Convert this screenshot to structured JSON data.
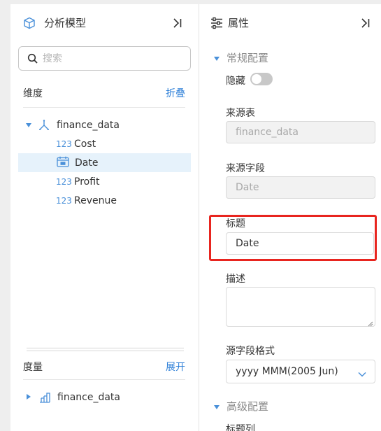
{
  "left_panel": {
    "title": "分析模型",
    "search": {
      "placeholder": "搜索",
      "value": ""
    },
    "dimensions": {
      "label": "维度",
      "action": "折叠",
      "root": "finance_data",
      "fields": [
        {
          "icon": "123",
          "label": "Cost",
          "selected": false
        },
        {
          "icon": "calendar-icon",
          "label": "Date",
          "selected": true
        },
        {
          "icon": "123",
          "label": "Profit",
          "selected": false
        },
        {
          "icon": "123",
          "label": "Revenue",
          "selected": false
        }
      ]
    },
    "measures": {
      "label": "度量",
      "action": "展开",
      "root": "finance_data"
    }
  },
  "right_panel": {
    "title": "属性",
    "general_section": "常规配置",
    "hidden_label": "隐藏",
    "hidden_value": false,
    "source_table_label": "来源表",
    "source_table_value": "finance_data",
    "source_field_label": "来源字段",
    "source_field_value": "Date",
    "title_label": "标题",
    "title_value": "Date",
    "description_label": "描述",
    "description_value": "",
    "format_label": "源字段格式",
    "format_value": "yyyy MMM(2005 Jun)",
    "advanced_section": "高级配置",
    "title_column_label": "标题列"
  },
  "colors": {
    "accent": "#2f80d8",
    "selected_bg": "#e6f2fb",
    "highlight": "#e8251f"
  }
}
